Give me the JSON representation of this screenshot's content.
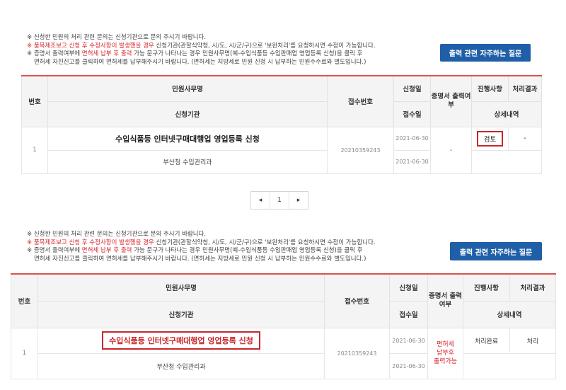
{
  "notices": {
    "line1": "※ 신청한 민원의 처리 관련 문의는 신청기관으로 문의 주시기 바랍니다.",
    "line2_red": "※ 품목제조보고 신청 후 수정사항이 발생했을 경우",
    "line2_rest": " 신청기관(관할식약청, 시/도, 시/군/구)으로 '보완처리'를 요청하시면 수정이 가능합니다.",
    "line3_pre": "※ 증명서 출력여부에 ",
    "line3_red": "면허세 납부 후 출력",
    "line3_rest": " 가능 문구가 나타나는 경우 민원사무명(예-수입식품등 수입판매업 영업등록 신청)을 클릭 후",
    "line4": "면허세 자진신고를 클릭하여 면허세를 납부해주시기 바랍니다. (면허세는 지방세로 민원 신청 시 납부하는 민원수수료와 별도입니다.)"
  },
  "faq_button": "출력 관련 자주하는 질문",
  "headers": {
    "no": "번호",
    "title": "민원사무명",
    "org": "신청기관",
    "receipt_no": "접수번호",
    "apply_date": "신청일",
    "receipt_date": "접수일",
    "cert_print": "증명서 출력여부",
    "progress": "진행사항",
    "result": "처리결과",
    "detail": "상세내역"
  },
  "row": {
    "no": "1",
    "title": "수입식품등 인터넷구매대행업 영업등록 신청",
    "org": "부산청 수입관리과",
    "receipt_no": "20210359243",
    "apply_date": "2021-06-30",
    "receipt_date": "2021-06-30"
  },
  "panel1_row": {
    "cert_print": "-",
    "progress": "검토",
    "result": "-"
  },
  "panel2_row": {
    "cert_print_l1": "면허세",
    "cert_print_l2": "납부후",
    "cert_print_l3": "출력가능",
    "progress": "처리완료",
    "result": "처리"
  },
  "pager": {
    "prev": "◂",
    "page": "1",
    "next": "▸"
  }
}
